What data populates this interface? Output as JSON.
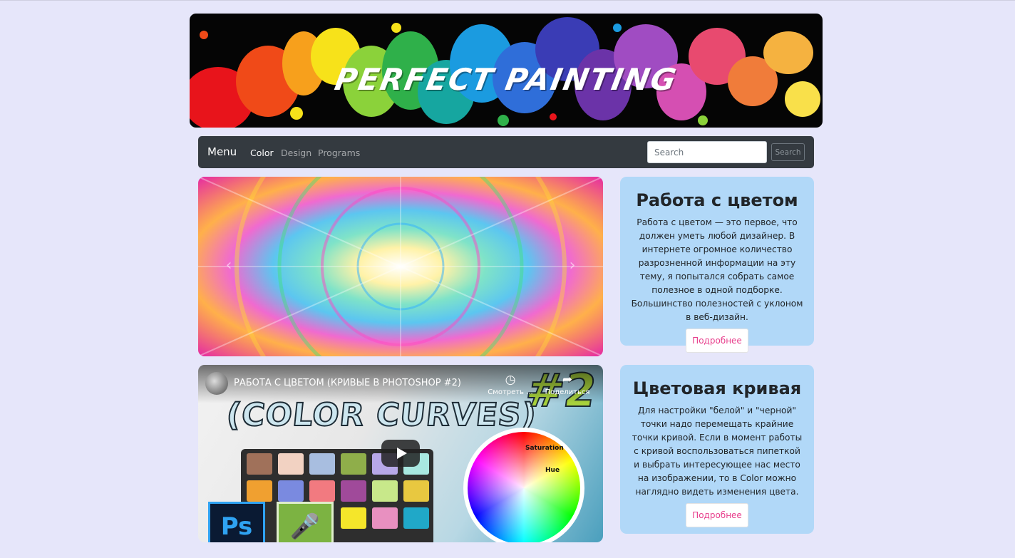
{
  "banner": {
    "title": "PERFECT PAINTING"
  },
  "navbar": {
    "brand": "Menu",
    "links": [
      {
        "label": "Color",
        "active": true
      },
      {
        "label": "Design",
        "active": false
      },
      {
        "label": "Programs",
        "active": false
      }
    ],
    "search_placeholder": "Search",
    "search_button": "Search"
  },
  "carousel": {
    "prev_icon": "chevron-left-icon",
    "next_icon": "chevron-right-icon"
  },
  "video": {
    "title": "РАБОТА С ЦВЕТОМ (КРИВЫЕ В PHOTOSHOP #2)",
    "thumb_heading": "(COLOR CURVES)",
    "thumb_number": "#2",
    "watch_later": "Смотреть ...",
    "share": "Поделиться",
    "wheel_saturation": "Saturation",
    "wheel_hue": "Hue",
    "ps_logo": "Ps"
  },
  "cards": [
    {
      "title": "Работа с цветом",
      "text": "Работа с цветом — это первое, что должен уметь любой дизайнер. В интернете огромное количество разрозненной информации на эту тему, я попытался собрать самое полезное в одной подборке. Большинство полезностей с уклоном в веб-дизайн.",
      "button": "Подробнее"
    },
    {
      "title": "Цветовая кривая",
      "text": "Для настройки \"белой\" и \"черной\" точки надо перемещать крайние точки кривой. Если в момент работы с кривой воспользоваться пипеткой и выбрать интересующее нас место на изображении, то в Color можно наглядно видеть изменения цвета.",
      "button": "Подробнее"
    }
  ],
  "colors": {
    "page_bg": "#e6e6fa",
    "navbar_bg": "#343a40",
    "card_bg": "#b1d8f8",
    "link_pink": "#e83e8c"
  }
}
